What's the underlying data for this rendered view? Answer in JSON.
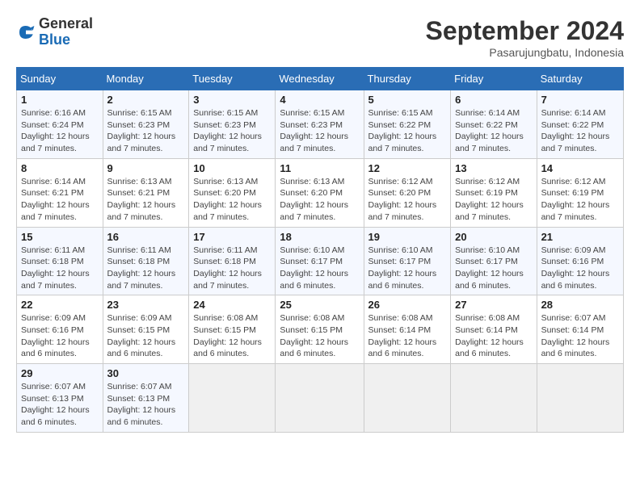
{
  "header": {
    "logo": {
      "general": "General",
      "blue": "Blue"
    },
    "title": "September 2024",
    "location": "Pasarujungbatu, Indonesia"
  },
  "weekdays": [
    "Sunday",
    "Monday",
    "Tuesday",
    "Wednesday",
    "Thursday",
    "Friday",
    "Saturday"
  ],
  "weeks": [
    [
      {
        "day": "1",
        "sunrise": "6:16 AM",
        "sunset": "6:24 PM",
        "daylight": "12 hours and 7 minutes."
      },
      {
        "day": "2",
        "sunrise": "6:15 AM",
        "sunset": "6:23 PM",
        "daylight": "12 hours and 7 minutes."
      },
      {
        "day": "3",
        "sunrise": "6:15 AM",
        "sunset": "6:23 PM",
        "daylight": "12 hours and 7 minutes."
      },
      {
        "day": "4",
        "sunrise": "6:15 AM",
        "sunset": "6:23 PM",
        "daylight": "12 hours and 7 minutes."
      },
      {
        "day": "5",
        "sunrise": "6:15 AM",
        "sunset": "6:22 PM",
        "daylight": "12 hours and 7 minutes."
      },
      {
        "day": "6",
        "sunrise": "6:14 AM",
        "sunset": "6:22 PM",
        "daylight": "12 hours and 7 minutes."
      },
      {
        "day": "7",
        "sunrise": "6:14 AM",
        "sunset": "6:22 PM",
        "daylight": "12 hours and 7 minutes."
      }
    ],
    [
      {
        "day": "8",
        "sunrise": "6:14 AM",
        "sunset": "6:21 PM",
        "daylight": "12 hours and 7 minutes."
      },
      {
        "day": "9",
        "sunrise": "6:13 AM",
        "sunset": "6:21 PM",
        "daylight": "12 hours and 7 minutes."
      },
      {
        "day": "10",
        "sunrise": "6:13 AM",
        "sunset": "6:20 PM",
        "daylight": "12 hours and 7 minutes."
      },
      {
        "day": "11",
        "sunrise": "6:13 AM",
        "sunset": "6:20 PM",
        "daylight": "12 hours and 7 minutes."
      },
      {
        "day": "12",
        "sunrise": "6:12 AM",
        "sunset": "6:20 PM",
        "daylight": "12 hours and 7 minutes."
      },
      {
        "day": "13",
        "sunrise": "6:12 AM",
        "sunset": "6:19 PM",
        "daylight": "12 hours and 7 minutes."
      },
      {
        "day": "14",
        "sunrise": "6:12 AM",
        "sunset": "6:19 PM",
        "daylight": "12 hours and 7 minutes."
      }
    ],
    [
      {
        "day": "15",
        "sunrise": "6:11 AM",
        "sunset": "6:18 PM",
        "daylight": "12 hours and 7 minutes."
      },
      {
        "day": "16",
        "sunrise": "6:11 AM",
        "sunset": "6:18 PM",
        "daylight": "12 hours and 7 minutes."
      },
      {
        "day": "17",
        "sunrise": "6:11 AM",
        "sunset": "6:18 PM",
        "daylight": "12 hours and 7 minutes."
      },
      {
        "day": "18",
        "sunrise": "6:10 AM",
        "sunset": "6:17 PM",
        "daylight": "12 hours and 6 minutes."
      },
      {
        "day": "19",
        "sunrise": "6:10 AM",
        "sunset": "6:17 PM",
        "daylight": "12 hours and 6 minutes."
      },
      {
        "day": "20",
        "sunrise": "6:10 AM",
        "sunset": "6:17 PM",
        "daylight": "12 hours and 6 minutes."
      },
      {
        "day": "21",
        "sunrise": "6:09 AM",
        "sunset": "6:16 PM",
        "daylight": "12 hours and 6 minutes."
      }
    ],
    [
      {
        "day": "22",
        "sunrise": "6:09 AM",
        "sunset": "6:16 PM",
        "daylight": "12 hours and 6 minutes."
      },
      {
        "day": "23",
        "sunrise": "6:09 AM",
        "sunset": "6:15 PM",
        "daylight": "12 hours and 6 minutes."
      },
      {
        "day": "24",
        "sunrise": "6:08 AM",
        "sunset": "6:15 PM",
        "daylight": "12 hours and 6 minutes."
      },
      {
        "day": "25",
        "sunrise": "6:08 AM",
        "sunset": "6:15 PM",
        "daylight": "12 hours and 6 minutes."
      },
      {
        "day": "26",
        "sunrise": "6:08 AM",
        "sunset": "6:14 PM",
        "daylight": "12 hours and 6 minutes."
      },
      {
        "day": "27",
        "sunrise": "6:08 AM",
        "sunset": "6:14 PM",
        "daylight": "12 hours and 6 minutes."
      },
      {
        "day": "28",
        "sunrise": "6:07 AM",
        "sunset": "6:14 PM",
        "daylight": "12 hours and 6 minutes."
      }
    ],
    [
      {
        "day": "29",
        "sunrise": "6:07 AM",
        "sunset": "6:13 PM",
        "daylight": "12 hours and 6 minutes."
      },
      {
        "day": "30",
        "sunrise": "6:07 AM",
        "sunset": "6:13 PM",
        "daylight": "12 hours and 6 minutes."
      },
      null,
      null,
      null,
      null,
      null
    ]
  ]
}
